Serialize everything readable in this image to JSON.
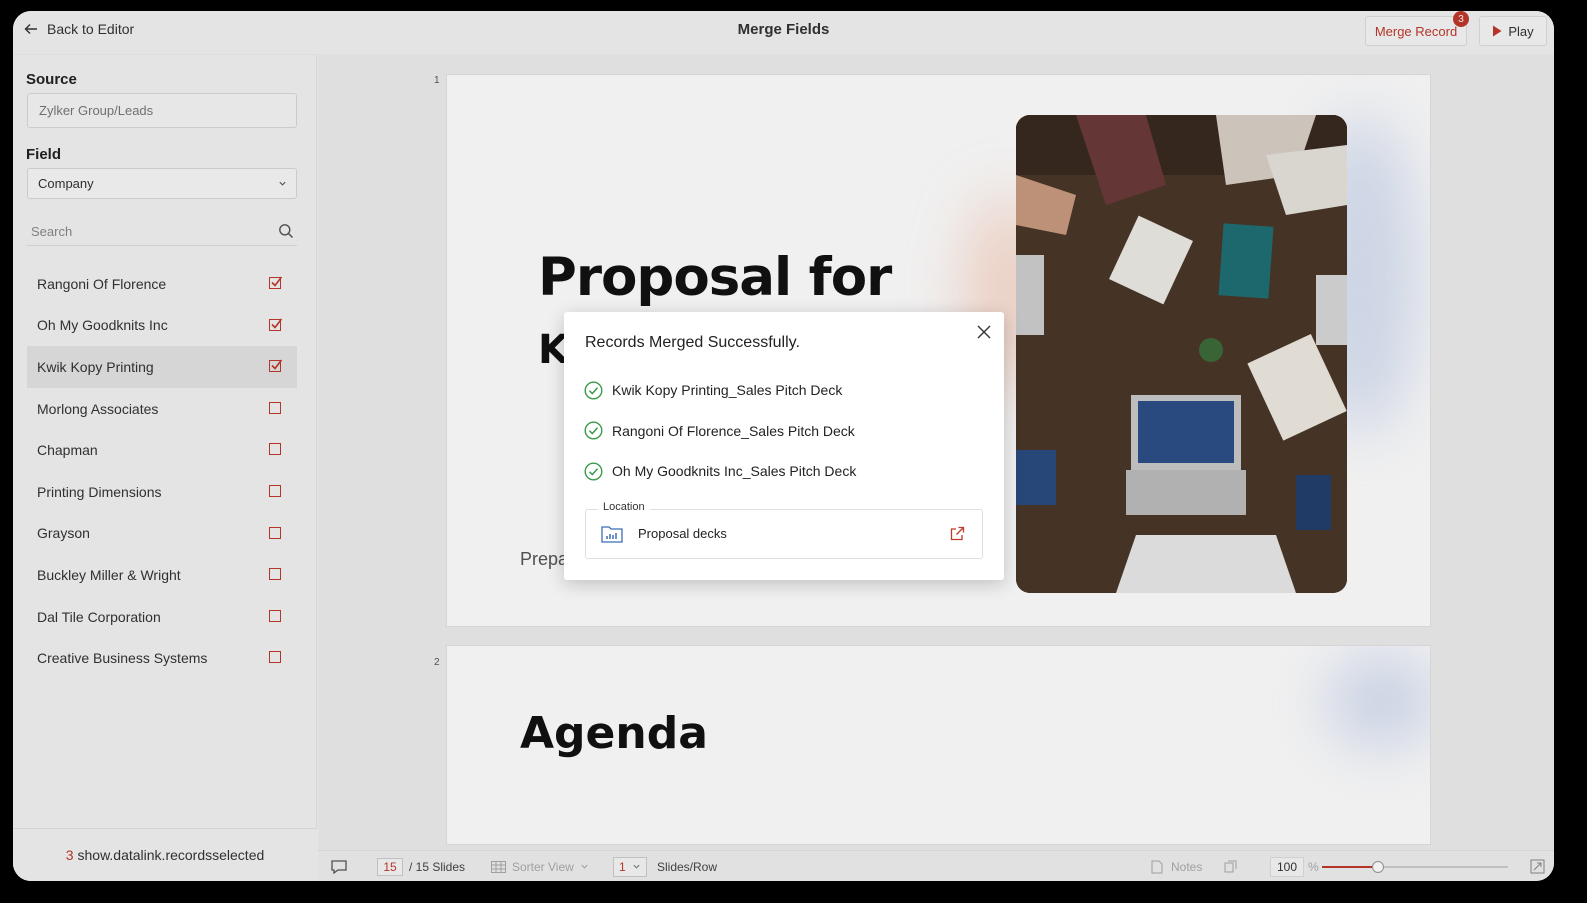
{
  "header": {
    "back_label": "Back to Editor",
    "title": "Merge Fields",
    "merge_record_label": "Merge Record",
    "merge_record_count": "3",
    "play_label": "Play"
  },
  "sidebar": {
    "source_label": "Source",
    "source_value": "Zylker Group/Leads",
    "field_label": "Field",
    "field_value": "Company",
    "search_placeholder": "Search",
    "records": [
      {
        "name": "Rangoni Of Florence",
        "checked": true
      },
      {
        "name": "Oh My Goodknits Inc",
        "checked": true
      },
      {
        "name": "Kwik Kopy Printing",
        "checked": true
      },
      {
        "name": "Morlong Associates",
        "checked": false
      },
      {
        "name": "Chapman",
        "checked": false
      },
      {
        "name": "Printing Dimensions",
        "checked": false
      },
      {
        "name": "Grayson",
        "checked": false
      },
      {
        "name": "Buckley Miller & Wright",
        "checked": false
      },
      {
        "name": "Dal Tile Corporation",
        "checked": false
      },
      {
        "name": "Creative Business Systems",
        "checked": false
      }
    ],
    "footer_count": "3",
    "footer_text": "show.datalink.recordsselected"
  },
  "slides": {
    "slide1_number": "1",
    "slide1_title_line1": "Proposal for",
    "slide1_title_line2": "K",
    "slide1_prepared": "Prepa",
    "slide2_number": "2",
    "slide2_title": "Agenda"
  },
  "bottombar": {
    "current_slide": "15",
    "total_slides": "/ 15 Slides",
    "sorter_view": "Sorter View",
    "slides_per_row": "1",
    "slides_row_label": "Slides/Row",
    "notes_label": "Notes",
    "zoom_value": "100",
    "zoom_unit": "%"
  },
  "modal": {
    "title": "Records Merged Successfully.",
    "items": [
      "Kwik Kopy Printing_Sales Pitch Deck",
      "Rangoni Of Florence_Sales Pitch Deck",
      "Oh My Goodknits Inc_Sales Pitch Deck"
    ],
    "location_label": "Location",
    "location_name": "Proposal decks"
  },
  "colors": {
    "accent": "#c0392b",
    "success": "#3a9b4b",
    "folder": "#3b6fb6"
  }
}
